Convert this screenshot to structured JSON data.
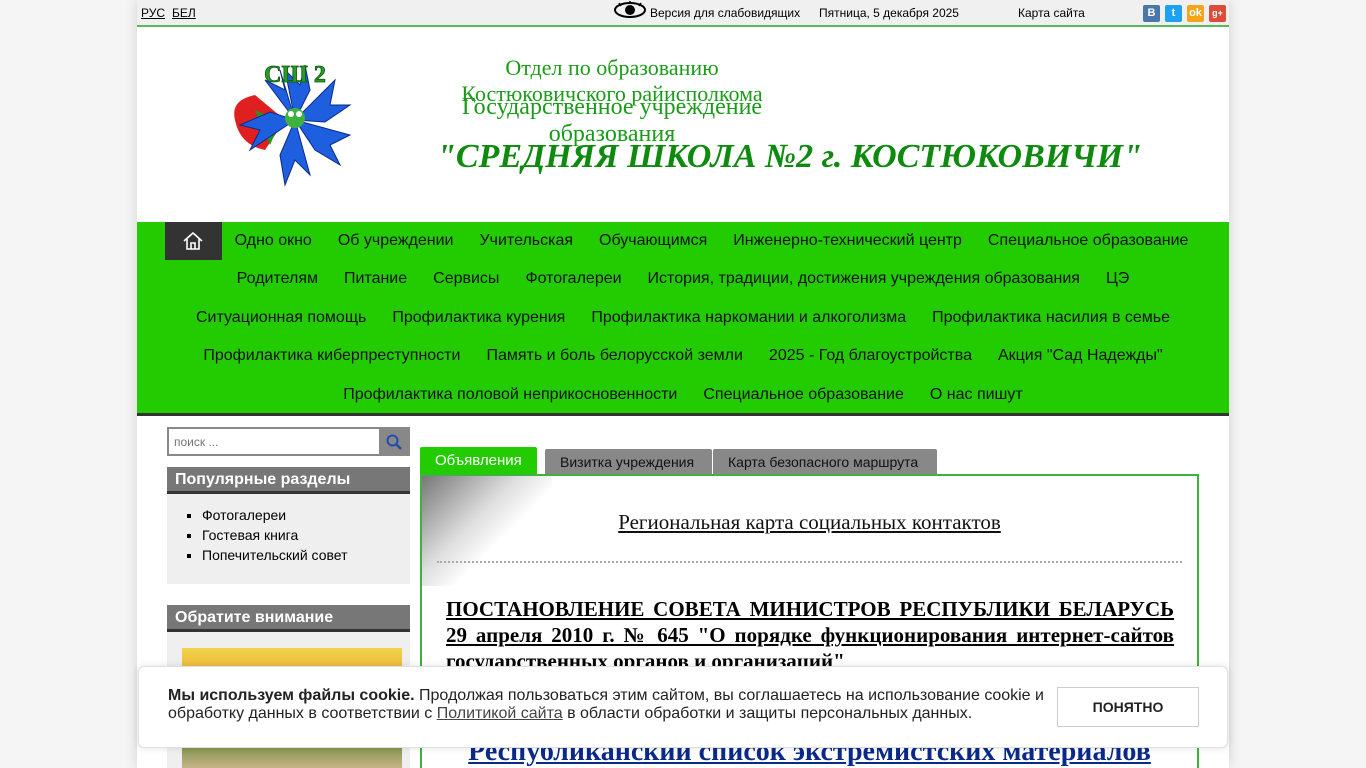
{
  "topbar": {
    "lang_ru": "РУС",
    "lang_by": "БЕЛ",
    "low_vision": "Версия для слабовидящих",
    "date": "Пятница, 5 декабря 2025",
    "sitemap": "Карта сайта",
    "social": [
      "В",
      "t",
      "ok",
      "g+"
    ]
  },
  "header": {
    "logo_text": "СШ 2",
    "line1": "Отдел по образованию Костюковичского райисполкома",
    "line2": "Государственное учреждение образования",
    "line3": "\"СРЕДНЯЯ ШКОЛА №2 г. КОСТЮКОВИЧИ\""
  },
  "nav": {
    "rows": [
      [
        "Одно окно",
        "Об учреждении",
        "Учительская",
        "Обучающимся",
        "Инженерно-технический центр",
        "Специальное образование"
      ],
      [
        "Родителям",
        "Питание",
        "Сервисы",
        "Фотогалереи",
        "История, традиции, достижения учреждения образования",
        "ЦЭ"
      ],
      [
        "Ситуационная помощь",
        "Профилактика курения",
        "Профилактика наркомании и алкоголизма",
        "Профилактика насилия в семье"
      ],
      [
        "Профилактика киберпреступности",
        "Память и боль белорусской земли",
        "2025 - Год благоустройства",
        "Акция \"Сад Надежды\""
      ],
      [
        "Профилактика половой неприкосновенности",
        "Специальное образование",
        "О нас пишут"
      ]
    ]
  },
  "sidebar": {
    "search_placeholder": "поиск ...",
    "popular_title": "Популярные разделы",
    "popular_items": [
      "Фотогалереи",
      "Гостевая книга",
      "Попечительский совет"
    ],
    "attention_title": "Обратите внимание"
  },
  "tabs": [
    "Объявления",
    "Визитка учреждения",
    "Карта безопасного маршрута"
  ],
  "content": {
    "regional_link": "Региональная карта социальных контактов",
    "decree": "ПОСТАНОВЛЕНИЕ СОВЕТА МИНИСТРОВ РЕСПУБЛИКИ БЕЛАРУСЬ 29 апреля 2010 г. № 645 \"О порядке функционирования интернет-сайтов государственных органов и организаций\"",
    "extremist": "Республиканский список экстремистских материалов"
  },
  "cookie": {
    "bold": "Мы используем файлы cookie.",
    "text1": " Продолжая пользоваться этим сайтом, вы соглашаетесь на использование cookie и обработку данных в соответствии с ",
    "link": "Политикой сайта",
    "text2": " в области обработки и защиты персональных данных.",
    "button": "ПОНЯТНО"
  },
  "colors": {
    "brand_green": "#22cc00",
    "title_green": "#1a9b1a"
  }
}
